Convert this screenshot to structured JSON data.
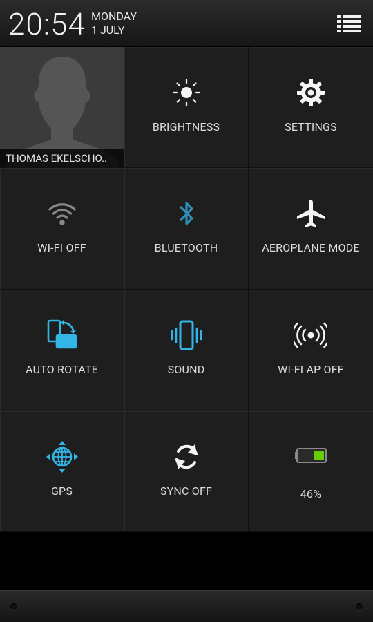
{
  "status": {
    "time": "20:54",
    "day": "MONDAY",
    "date": "1 JULY"
  },
  "profile": {
    "name": "THOMAS EKELSCHO.."
  },
  "tiles": [
    {
      "label": "BRIGHTNESS",
      "icon": "brightness-icon",
      "active": false
    },
    {
      "label": "SETTINGS",
      "icon": "settings-gear-icon",
      "active": false
    },
    {
      "label": "WI-FI OFF",
      "icon": "wifi-icon",
      "active": false
    },
    {
      "label": "BLUETOOTH",
      "icon": "bluetooth-icon",
      "active": true
    },
    {
      "label": "AEROPLANE MODE",
      "icon": "aeroplane-icon",
      "active": false
    },
    {
      "label": "AUTO ROTATE",
      "icon": "auto-rotate-icon",
      "active": true
    },
    {
      "label": "SOUND",
      "icon": "vibrate-icon",
      "active": true
    },
    {
      "label": "WI-FI AP OFF",
      "icon": "hotspot-icon",
      "active": false
    },
    {
      "label": "GPS",
      "icon": "gps-icon",
      "active": true
    },
    {
      "label": "SYNC OFF",
      "icon": "sync-icon",
      "active": false
    },
    {
      "label": "46%",
      "icon": "battery-icon",
      "active": false
    }
  ],
  "battery": {
    "level_percent": 46
  },
  "colors": {
    "accent": "#33b5e5",
    "inactive": "#8a8a8a",
    "white": "#f5f5f5",
    "battery": "#66cc00"
  }
}
